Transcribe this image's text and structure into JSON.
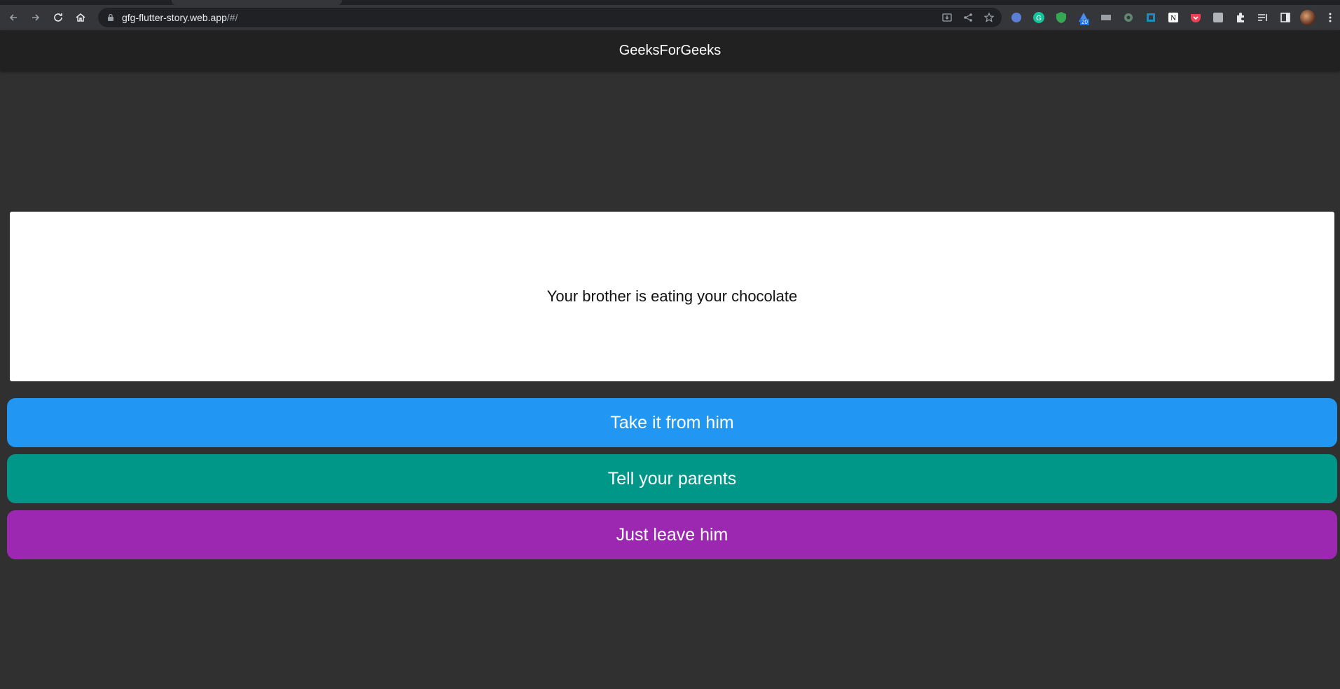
{
  "browser": {
    "url_host": "gfg-flutter-story.web.app",
    "url_path": "/#/",
    "extension_badge": "20",
    "icons": [
      "back-icon",
      "forward-icon",
      "reload-icon",
      "home-icon",
      "lock-icon",
      "install-icon",
      "share-icon",
      "bookmark-star-icon",
      "extensions-puzzle-icon",
      "reading-list-icon",
      "side-panel-icon",
      "menu-kebab-icon"
    ]
  },
  "app": {
    "title": "GeeksForGeeks",
    "story": "Your brother is eating your chocolate",
    "choices": [
      {
        "label": "Take it from him",
        "color": "#2196f3"
      },
      {
        "label": "Tell your parents",
        "color": "#009688"
      },
      {
        "label": "Just leave him",
        "color": "#9c27b0"
      }
    ],
    "background_color": "#303030",
    "appbar_color": "#212121"
  }
}
